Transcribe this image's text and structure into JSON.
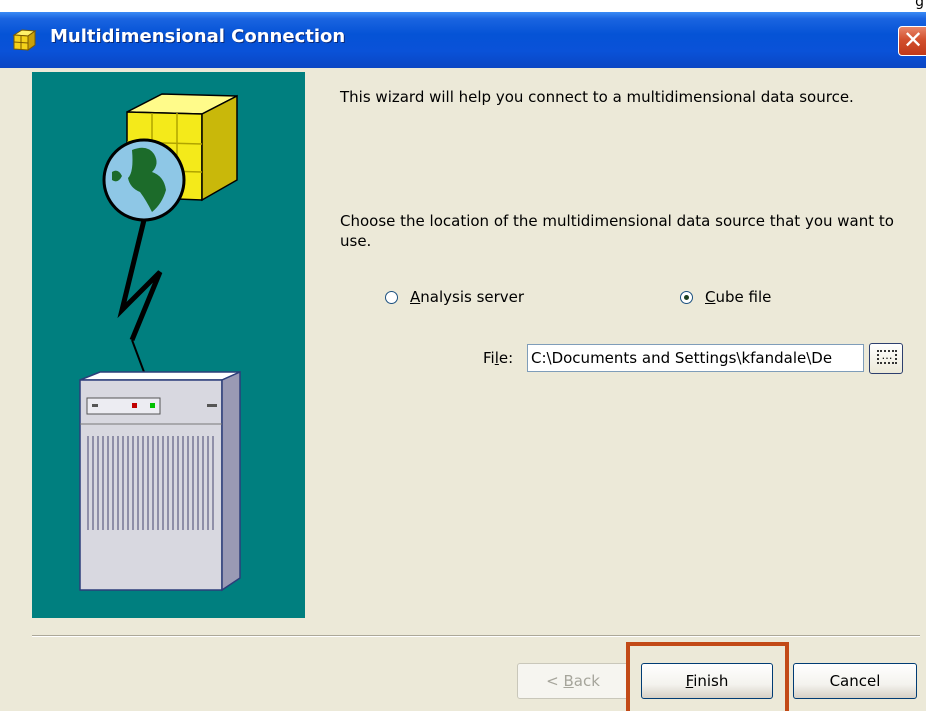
{
  "window": {
    "title": "Multidimensional Connection",
    "corner_fragment": "g"
  },
  "intro_text": "This wizard will help you connect to a multidimensional data source.",
  "location_prompt": "Choose the location of the multidimensional data source that you want to use.",
  "options": [
    {
      "label": "Analysis server",
      "accel": "A",
      "rest": "nalysis server",
      "selected": false
    },
    {
      "label": "Cube file",
      "accel": "C",
      "rest": "ube file",
      "selected": true
    }
  ],
  "file": {
    "label_pre": "Fi",
    "label_accel": "l",
    "label_post": "e:",
    "value": "C:\\Documents and Settings\\kfandale\\De"
  },
  "buttons": {
    "back_pre": "< ",
    "back_accel": "B",
    "back_post": "ack",
    "finish_accel": "F",
    "finish_post": "inish",
    "cancel": "Cancel"
  },
  "colors": {
    "title_bar": "#0a52d8",
    "art_background": "#007f7f",
    "dialog_background": "#ece9d8",
    "highlight": "#c24a17"
  }
}
